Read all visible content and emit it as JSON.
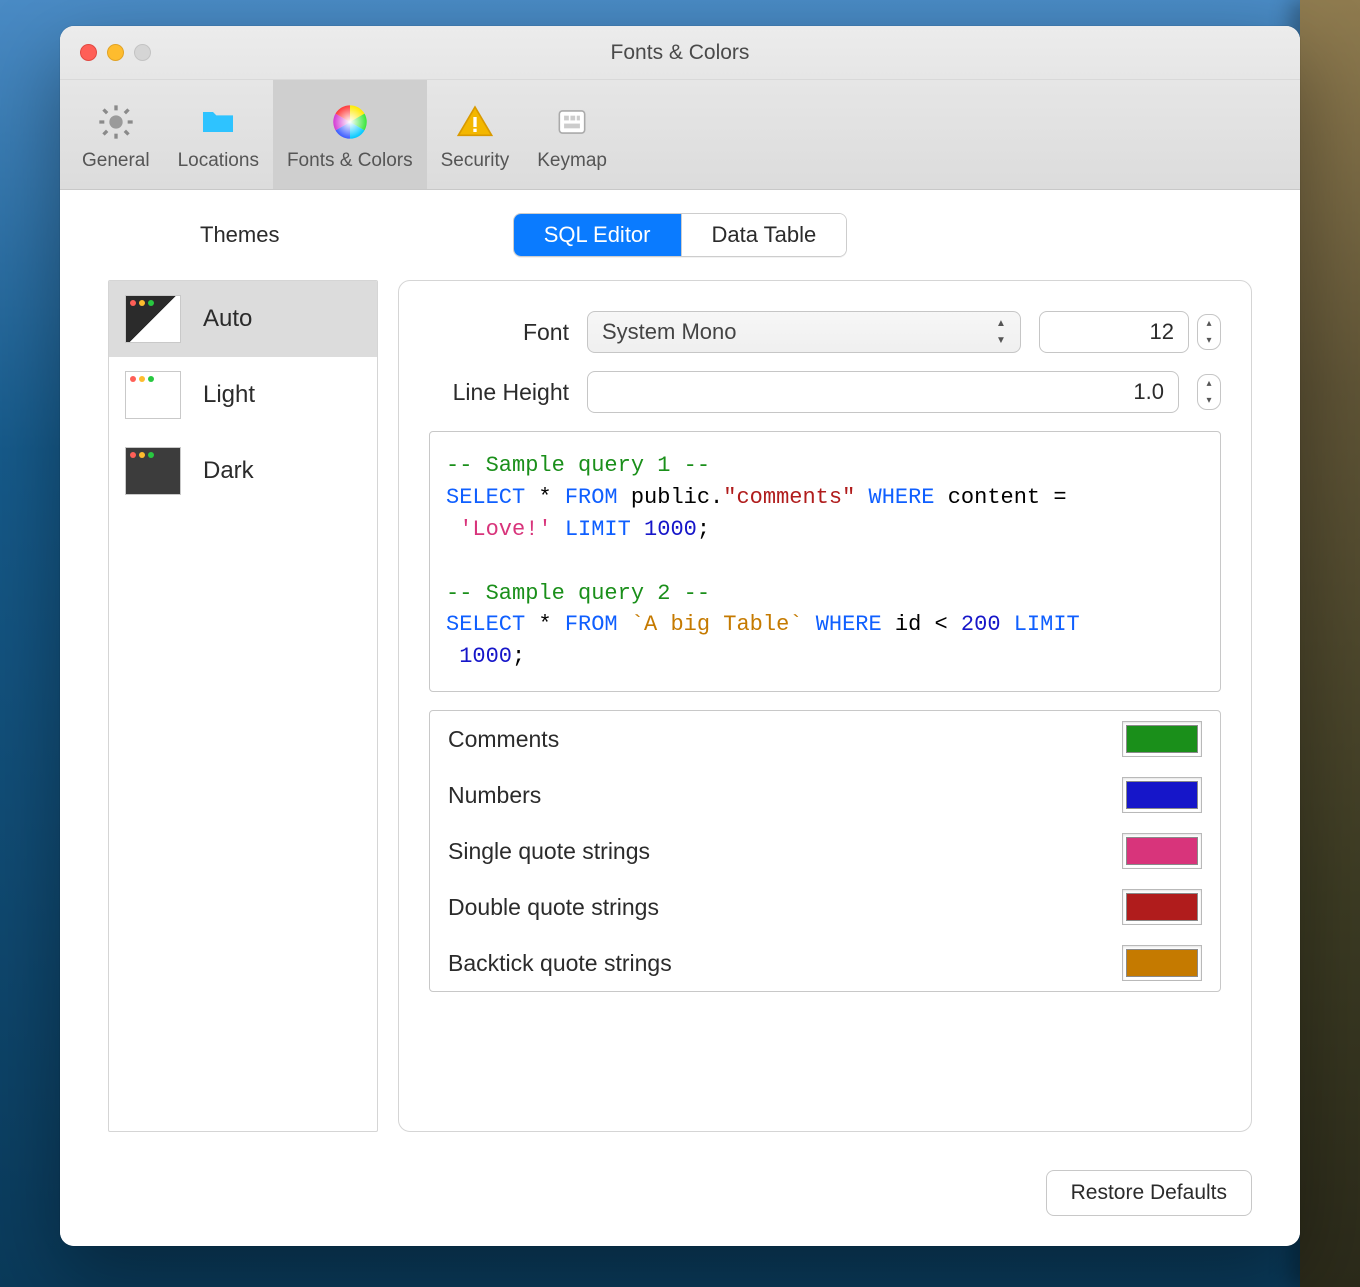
{
  "window": {
    "title": "Fonts & Colors"
  },
  "toolbar": {
    "tabs": [
      {
        "label": "General"
      },
      {
        "label": "Locations"
      },
      {
        "label": "Fonts & Colors"
      },
      {
        "label": "Security"
      },
      {
        "label": "Keymap"
      }
    ],
    "selected_index": 2
  },
  "themes": {
    "header": "Themes",
    "items": [
      {
        "label": "Auto"
      },
      {
        "label": "Light"
      },
      {
        "label": "Dark"
      }
    ],
    "selected_index": 0
  },
  "segments": {
    "items": [
      "SQL Editor",
      "Data Table"
    ],
    "active_index": 0
  },
  "font": {
    "label": "Font",
    "selected": "System Mono",
    "size": "12"
  },
  "line_height": {
    "label": "Line  Height",
    "value": "1.0"
  },
  "preview": {
    "c1": "-- Sample query 1 --",
    "kw_select": "SELECT",
    "kw_from": "FROM",
    "kw_where": "WHERE",
    "kw_limit": "LIMIT",
    "star": "*",
    "tbl1_schema": "public.",
    "tbl1_dq": "\"comments\"",
    "col_content": "content =",
    "sq_love": "'Love!'",
    "n1000": "1000",
    "semi": ";",
    "c2": "-- Sample query 2 --",
    "bt_table": "`A big Table`",
    "col_id": "id <",
    "n200": "200"
  },
  "color_items": [
    {
      "label": "Comments",
      "color": "#1a8f1a"
    },
    {
      "label": "Numbers",
      "color": "#1616c9"
    },
    {
      "label": "Single quote strings",
      "color": "#d8347b"
    },
    {
      "label": "Double quote strings",
      "color": "#b01c1c"
    },
    {
      "label": "Backtick quote strings",
      "color": "#c57a00"
    }
  ],
  "restore_label": "Restore Defaults"
}
